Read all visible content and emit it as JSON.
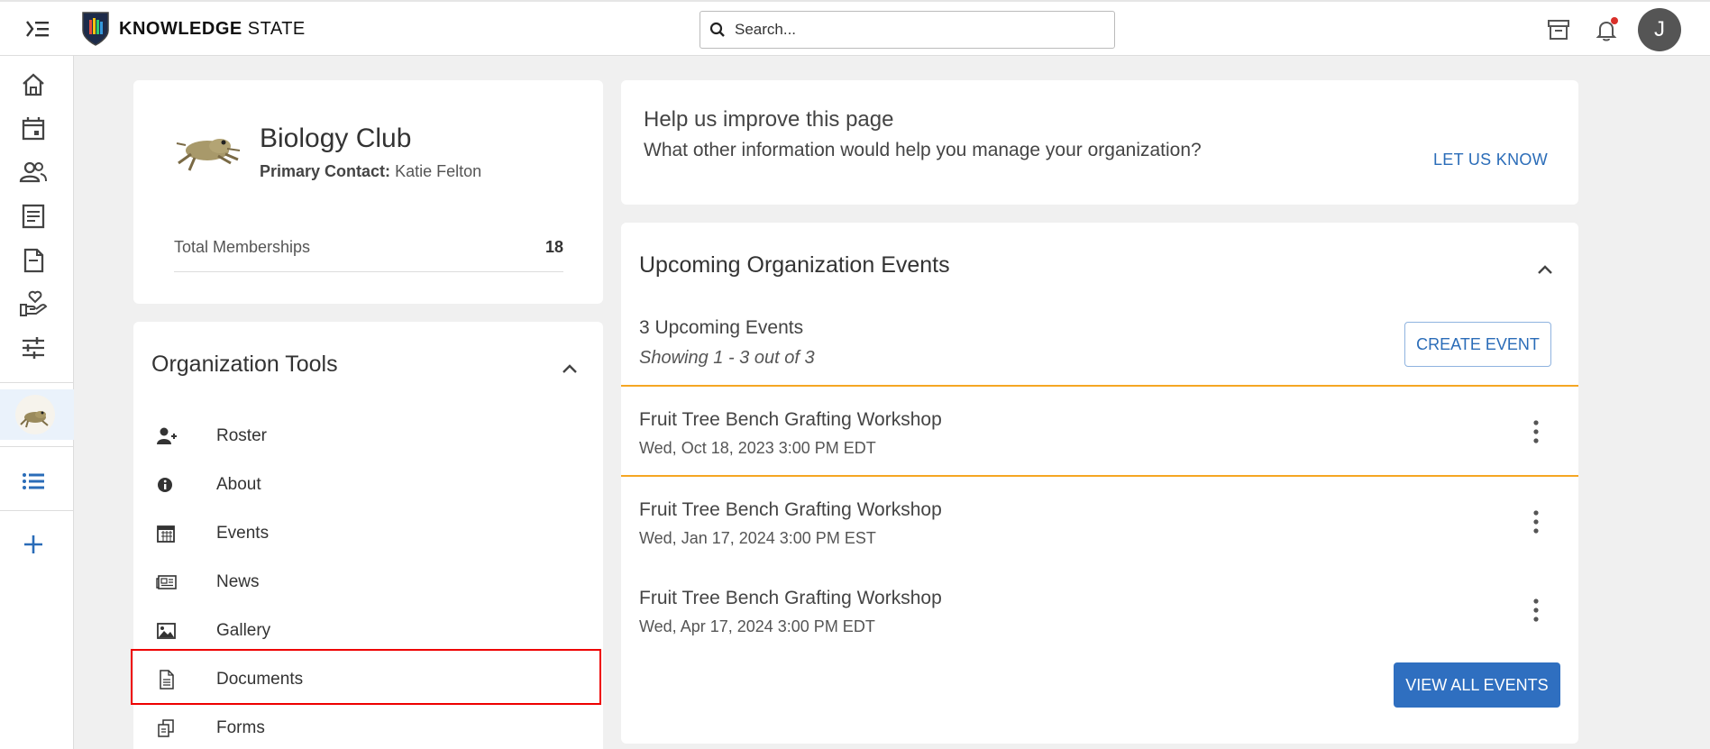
{
  "header": {
    "brand_bold": "KNOWLEDGE",
    "brand_light": "STATE",
    "search_placeholder": "Search...",
    "avatar_initial": "J"
  },
  "organization": {
    "name": "Biology Club",
    "primary_contact_label": "Primary Contact:",
    "primary_contact_name": "Katie Felton",
    "total_memberships_label": "Total Memberships",
    "total_memberships": "18"
  },
  "tools": {
    "title": "Organization Tools",
    "items": [
      {
        "label": "Roster",
        "icon": "user-plus-icon"
      },
      {
        "label": "About",
        "icon": "info-icon"
      },
      {
        "label": "Events",
        "icon": "calendar-icon"
      },
      {
        "label": "News",
        "icon": "newspaper-icon"
      },
      {
        "label": "Gallery",
        "icon": "image-icon"
      },
      {
        "label": "Documents",
        "icon": "document-icon"
      },
      {
        "label": "Forms",
        "icon": "forms-icon"
      }
    ]
  },
  "help": {
    "title": "Help us improve this page",
    "subtitle": "What other information would help you manage your organization?",
    "link": "LET US KNOW"
  },
  "events": {
    "title": "Upcoming Organization Events",
    "count_text": "3 Upcoming Events",
    "showing_text": "Showing 1 - 3 out of 3",
    "create_label": "CREATE EVENT",
    "view_all_label": "VIEW ALL EVENTS",
    "items": [
      {
        "name": "Fruit Tree Bench Grafting Workshop",
        "date": "Wed, Oct 18, 2023 3:00 PM EDT"
      },
      {
        "name": "Fruit Tree Bench Grafting Workshop",
        "date": "Wed, Jan 17, 2024 3:00 PM EST"
      },
      {
        "name": "Fruit Tree Bench Grafting Workshop",
        "date": "Wed, Apr 17, 2024 3:00 PM EDT"
      }
    ]
  },
  "colors": {
    "accent": "#2f6fc0",
    "highlight_row": "#f5a623",
    "selection_box": "#e00000"
  }
}
